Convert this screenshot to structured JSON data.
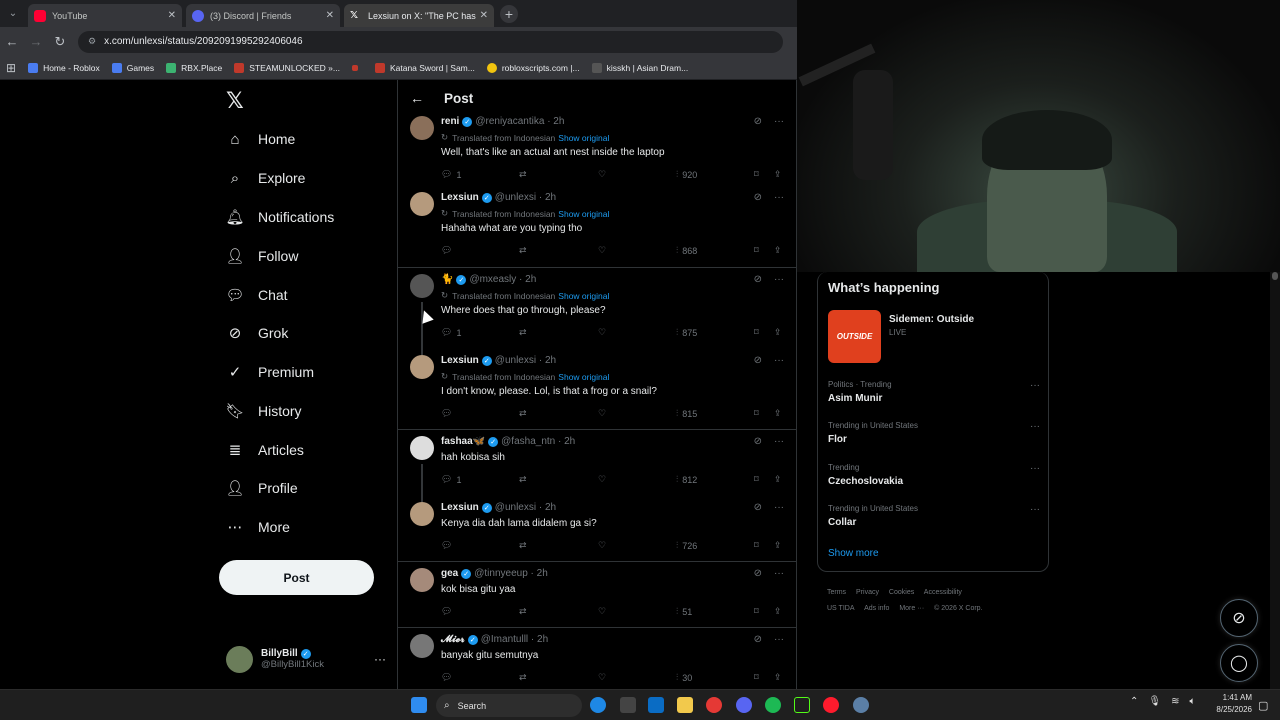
{
  "browser": {
    "tabs": [
      {
        "title": "YouTube",
        "color": "#ff0033"
      },
      {
        "title": "(3) Discord | Friends",
        "color": "#5865f2"
      },
      {
        "title": "Lexsiun on X: \"The PC has a pro",
        "color": "#ffffff"
      }
    ],
    "url": "x.com/unlexsi/status/2092091995292406046",
    "bookmarks": [
      {
        "label": "Home - Roblox",
        "color": "#4a7cf0"
      },
      {
        "label": "Games",
        "color": "#4a7cf0"
      },
      {
        "label": "RBX.Place",
        "color": "#3cb371"
      },
      {
        "label": "STEAMUNLOCKED »...",
        "color": "#c0392b"
      },
      {
        "label": "",
        "color": "#c0392b"
      },
      {
        "label": "Katana Sword | Sam...",
        "color": "#c0392b"
      },
      {
        "label": "robloxscripts.com |...",
        "color": "#f1c40f"
      },
      {
        "label": "kisskh | Asian Dram...",
        "color": "#555555"
      }
    ]
  },
  "sidebar": {
    "logo": "𝕏",
    "items": [
      {
        "label": "Home",
        "icon": "⌂"
      },
      {
        "label": "Explore",
        "icon": "⌕"
      },
      {
        "label": "Notifications",
        "icon": "🔔︎"
      },
      {
        "label": "Follow",
        "icon": "👤︎"
      },
      {
        "label": "Chat",
        "icon": "💬︎"
      },
      {
        "label": "Grok",
        "icon": "⊘"
      },
      {
        "label": "Premium",
        "icon": "✓"
      },
      {
        "label": "History",
        "icon": "🔖︎"
      },
      {
        "label": "Articles",
        "icon": "≣"
      },
      {
        "label": "Profile",
        "icon": "👤︎"
      },
      {
        "label": "More",
        "icon": "⋯"
      }
    ],
    "post_label": "Post",
    "account": {
      "name": "BillyBill",
      "handle": "@BillyBill1Kick",
      "more": "···"
    }
  },
  "main": {
    "title": "Post",
    "back": "←",
    "translated_label": "Translated from Indonesian",
    "show_original": "Show original",
    "tweets": [
      {
        "name": "reni",
        "handle": "@reniyacantika · 2h",
        "translated": true,
        "text": "Well, that's like an actual ant nest inside the laptop",
        "replies": "1",
        "views": "920",
        "avatar": "#8a6f5a"
      },
      {
        "name": "Lexsiun",
        "handle": "@unlexsi · 2h",
        "translated": true,
        "text": "Hahaha what are you typing tho",
        "replies": "",
        "views": "868",
        "avatar": "#b59a7d"
      },
      {
        "name": "🐈",
        "handle": "@mxeasly · 2h",
        "translated": true,
        "text": "Where does that go through, please?",
        "replies": "1",
        "views": "875",
        "avatar": "#555555"
      },
      {
        "name": "Lexsiun",
        "handle": "@unlexsi · 2h",
        "translated": true,
        "text": "I don't know, please. Lol, is that a frog or a snail?",
        "replies": "",
        "views": "815",
        "avatar": "#b59a7d"
      },
      {
        "name": "fashaa🦋",
        "handle": "@fasha_ntn · 2h",
        "translated": false,
        "text": "hah kobisa sih",
        "replies": "1",
        "views": "812",
        "avatar": "#dddddd"
      },
      {
        "name": "Lexsiun",
        "handle": "@unlexsi · 2h",
        "translated": false,
        "text": "Kenya dia dah lama didalem ga si?",
        "replies": "",
        "views": "726",
        "avatar": "#b59a7d"
      },
      {
        "name": "gea",
        "handle": "@tinnyeeup · 2h",
        "translated": false,
        "text": "kok bisa gitu yaa",
        "replies": "",
        "views": "51",
        "avatar": "#a58a7a"
      },
      {
        "name": "𝓜𝓲𝓮𝓻",
        "handle": "@Imantulll · 2h",
        "translated": false,
        "text": "banyak gitu semutnya",
        "replies": "",
        "views": "30",
        "avatar": "#777777"
      }
    ]
  },
  "right": {
    "title": "What’s happening",
    "live": {
      "thumb": "OUTSIDE",
      "name": "Sidemen: Outside",
      "tag": "LIVE"
    },
    "trends": [
      {
        "context": "Politics · Trending",
        "name": "Asim Munir"
      },
      {
        "context": "Trending in United States",
        "name": "Flor"
      },
      {
        "context": "Trending",
        "name": "Czechoslovakia"
      },
      {
        "context": "Trending in United States",
        "name": "Collar"
      }
    ],
    "show_more": "Show more",
    "footer": [
      "Terms",
      "Privacy",
      "Cookies",
      "Accessibility",
      "US TIDA",
      "Ads info",
      "More ···",
      "© 2026 X Corp."
    ]
  },
  "taskbar": {
    "search": "Search",
    "time": "1:41 AM",
    "date": "8/25/2026"
  }
}
